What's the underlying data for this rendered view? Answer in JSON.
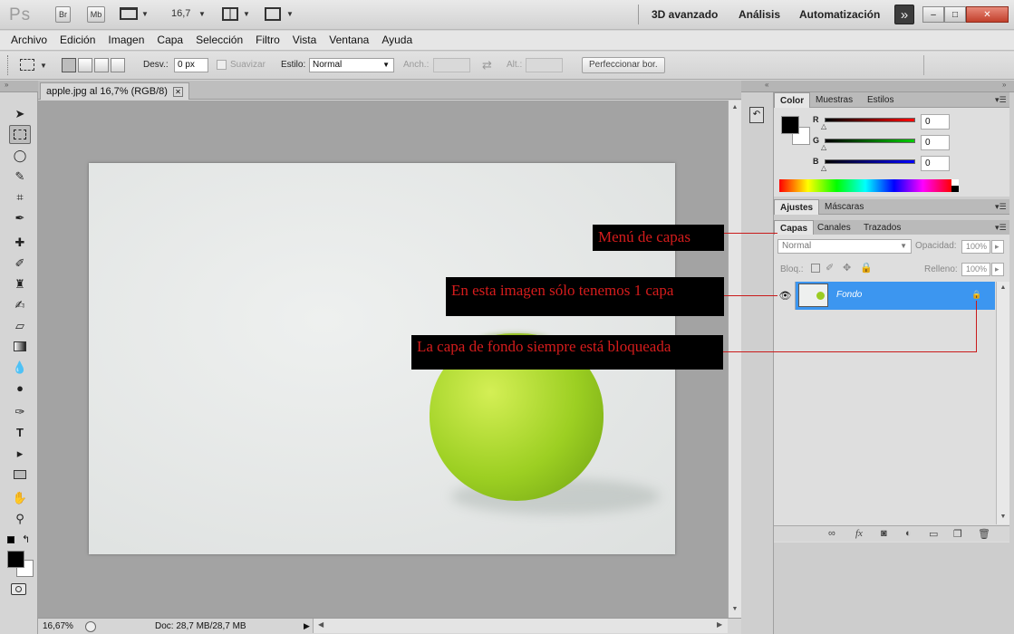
{
  "titlebar": {
    "app_logo": "Ps",
    "bridge_label": "Br",
    "minibridge_label": "Mb",
    "zoom": "16,7",
    "workspaces": [
      "3D avanzado",
      "Análisis",
      "Automatización"
    ],
    "overflow_label": "»",
    "window_min": "–",
    "window_max": "□",
    "window_close": "✕"
  },
  "menubar": {
    "items": [
      "Archivo",
      "Edición",
      "Imagen",
      "Capa",
      "Selección",
      "Filtro",
      "Vista",
      "Ventana",
      "Ayuda"
    ]
  },
  "options": {
    "feather_label": "Desv.:",
    "feather_value": "0 px",
    "antialias_label": "Suavizar",
    "style_label": "Estilo:",
    "style_value": "Normal",
    "width_label": "Anch.:",
    "height_label": "Alt.:",
    "refine_label": "Perfeccionar bor."
  },
  "document": {
    "tab_title": "apple.jpg al 16,7% (RGB/8)",
    "status_zoom": "16,67%",
    "status_doc": "Doc: 28,7 MB/28,7 MB"
  },
  "panels": {
    "color_tabs": [
      "Color",
      "Muestras",
      "Estilos"
    ],
    "channels": [
      {
        "label": "R",
        "value": "0",
        "gradient": "linear-gradient(to right,#000,#f00)"
      },
      {
        "label": "G",
        "value": "0",
        "gradient": "linear-gradient(to right,#000,#0c0)"
      },
      {
        "label": "B",
        "value": "0",
        "gradient": "linear-gradient(to right,#000,#00f)"
      }
    ],
    "adjust_tabs": [
      "Ajustes",
      "Máscaras"
    ],
    "layers_tabs": [
      "Capas",
      "Canales",
      "Trazados"
    ],
    "blend_mode": "Normal",
    "opacity_label": "Opacidad:",
    "opacity_value": "100%",
    "lock_label": "Bloq.:",
    "fill_label": "Relleno:",
    "fill_value": "100%",
    "layer_name": "Fondo"
  },
  "annotations": {
    "layers_menu": "Menú de capas",
    "one_layer": "En esta imagen sólo tenemos 1 capa",
    "locked_bg": "La capa de fondo siempre está bloqueada"
  },
  "colors": {
    "selection_blue": "#3c96f0",
    "annotation_red": "#d51c1c"
  }
}
